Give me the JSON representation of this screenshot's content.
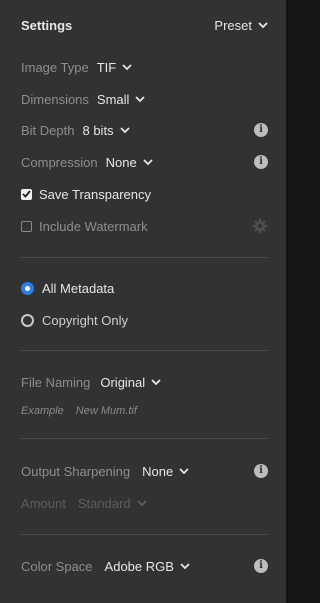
{
  "header": {
    "title": "Settings",
    "preset_label": "Preset"
  },
  "image_type": {
    "label": "Image Type",
    "value": "TIF"
  },
  "dimensions": {
    "label": "Dimensions",
    "value": "Small"
  },
  "bit_depth": {
    "label": "Bit Depth",
    "value": "8 bits"
  },
  "compression": {
    "label": "Compression",
    "value": "None"
  },
  "save_transparency": {
    "label": "Save Transparency",
    "checked": true
  },
  "include_watermark": {
    "label": "Include Watermark",
    "checked": false
  },
  "metadata": {
    "options": [
      {
        "label": "All Metadata",
        "selected": true
      },
      {
        "label": "Copyright Only",
        "selected": false
      }
    ]
  },
  "file_naming": {
    "label": "File Naming",
    "value": "Original",
    "example_label": "Example",
    "example_value": "New Mum.tif"
  },
  "output_sharpening": {
    "label": "Output Sharpening",
    "value": "None"
  },
  "amount": {
    "label": "Amount",
    "value": "Standard",
    "disabled": true
  },
  "color_space": {
    "label": "Color Space",
    "value": "Adobe RGB"
  },
  "colors": {
    "panel_bg": "#323232",
    "accent": "#2d7ee0",
    "label": "#8e8e8e",
    "value": "#e6e6e6"
  },
  "icons": {
    "info": "info-icon",
    "settings": "gear-icon",
    "dropdown": "chevron-down-icon"
  }
}
